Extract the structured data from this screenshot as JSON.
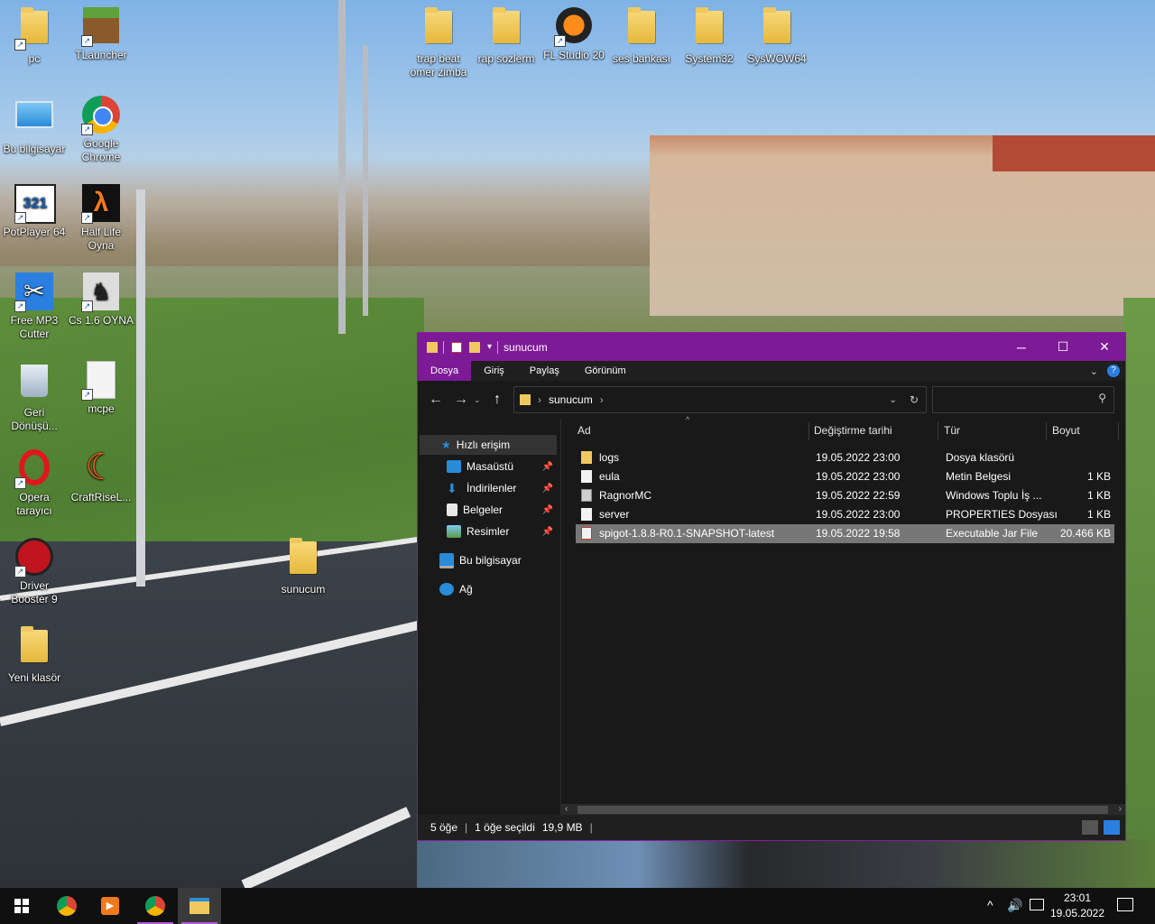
{
  "desktop": {
    "icons": [
      {
        "label": "pc"
      },
      {
        "label": "TLauncher"
      },
      {
        "label": "Bu bilgisayar"
      },
      {
        "label": "Google Chrome"
      },
      {
        "label": "PotPlayer 64"
      },
      {
        "label": "Half Life Oyna"
      },
      {
        "label": "Free MP3 Cutter"
      },
      {
        "label": "Cs 1.6 OYNA"
      },
      {
        "label": "Geri Dönüşü..."
      },
      {
        "label": "mcpe"
      },
      {
        "label": "Opera tarayıcı"
      },
      {
        "label": "CraftRiseL..."
      },
      {
        "label": "Driver Booster 9"
      },
      {
        "label": "Yeni klasör"
      },
      {
        "label": "trap beat omer zimba"
      },
      {
        "label": "rap sozlerm"
      },
      {
        "label": "FL Studio 20"
      },
      {
        "label": "ses bankası"
      },
      {
        "label": "System32"
      },
      {
        "label": "SysWOW64"
      },
      {
        "label": "sunucum"
      }
    ]
  },
  "window": {
    "title": "sunucum",
    "ribbon_tabs": [
      "Dosya",
      "Giriş",
      "Paylaş",
      "Görünüm"
    ],
    "address": {
      "folder": "sunucum"
    },
    "search_placeholder": "",
    "nav": {
      "quick_access": "Hızlı erişim",
      "pinned": [
        "Masaüstü",
        "İndirilenler",
        "Belgeler",
        "Resimler"
      ],
      "this_pc": "Bu bilgisayar",
      "network": "Ağ"
    },
    "columns": {
      "name": "Ad",
      "date": "Değiştirme tarihi",
      "type": "Tür",
      "size": "Boyut"
    },
    "files": [
      {
        "name": "logs",
        "date": "19.05.2022 23:00",
        "type": "Dosya klasörü",
        "size": "",
        "icon": "folder-icon"
      },
      {
        "name": "eula",
        "date": "19.05.2022 23:00",
        "type": "Metin Belgesi",
        "size": "1 KB",
        "icon": "text-file-icon"
      },
      {
        "name": "RagnorMC",
        "date": "19.05.2022 22:59",
        "type": "Windows Toplu İş ...",
        "size": "1 KB",
        "icon": "batch-file-icon"
      },
      {
        "name": "server",
        "date": "19.05.2022 23:00",
        "type": "PROPERTIES Dosyası",
        "size": "1 KB",
        "icon": "file-icon"
      },
      {
        "name": "spigot-1.8.8-R0.1-SNAPSHOT-latest",
        "date": "19.05.2022 19:58",
        "type": "Executable Jar File",
        "size": "20.466 KB",
        "icon": "jar-file-icon",
        "selected": true
      }
    ],
    "status": {
      "count": "5 öğe",
      "selected": "1 öğe seçildi",
      "size": "19,9 MB"
    },
    "accent": "#7d1a96"
  },
  "taskbar": {
    "time": "23:01",
    "date": "19.05.2022"
  }
}
